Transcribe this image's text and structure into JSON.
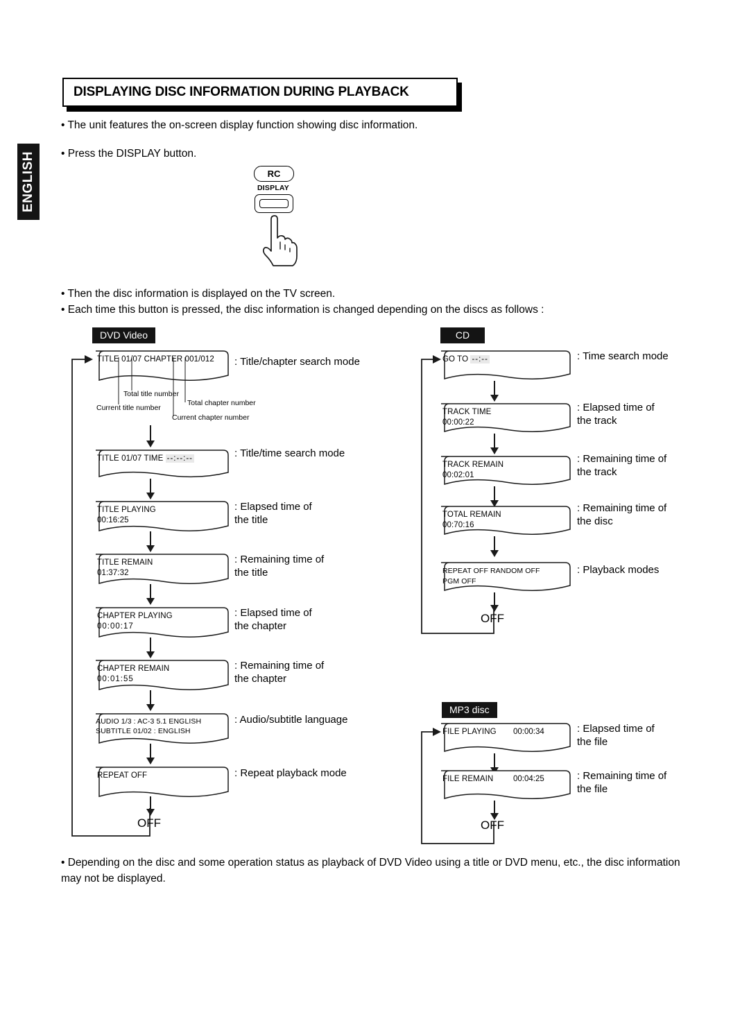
{
  "language_tab": "ENGLISH",
  "header": {
    "title": "DISPLAYING DISC INFORMATION DURING PLAYBACK"
  },
  "intro": {
    "bullet1": "• The unit features the on-screen display function showing disc information.",
    "bullet2": "• Press the DISPLAY button.",
    "bullet3": "• Then the disc information is displayed on the TV screen.",
    "bullet4": "• Each time this button is pressed, the disc information is changed depending on the discs as follows :"
  },
  "remote": {
    "rc_label": "RC",
    "display_label": "DISPLAY",
    "icon": "pointing-hand-icon"
  },
  "dvd": {
    "badge": "DVD Video",
    "steps": [
      {
        "line1": "TITLE 01/07 CHAPTER 001/012",
        "line2": "",
        "placeholder": "",
        "desc": ": Title/chapter search mode"
      },
      {
        "line1": "TITLE 01/07 TIME",
        "line2": "",
        "placeholder": "--:--:--",
        "desc": ": Title/time search mode"
      },
      {
        "line1": "TITLE PLAYING",
        "line2": "00:16:25",
        "placeholder": "",
        "desc": ": Elapsed time of\nthe title"
      },
      {
        "line1": "TITLE REMAIN",
        "line2": "01:37:32",
        "placeholder": "",
        "desc": ": Remaining time of\nthe title"
      },
      {
        "line1": "CHAPTER PLAYING",
        "line2": "00:00:17",
        "placeholder": "",
        "desc": ": Elapsed time of\nthe chapter"
      },
      {
        "line1": "CHAPTER REMAIN",
        "line2": "00:01:55",
        "placeholder": "",
        "desc": ": Remaining time of\nthe chapter"
      },
      {
        "line1": "AUDIO 1/3 :   AC-3   5.1    ENGLISH",
        "line2": "SUBTITLE  01/02 :  ENGLISH",
        "placeholder": "",
        "desc": ": Audio/subtitle language"
      },
      {
        "line1": "REPEAT  OFF",
        "line2": "",
        "placeholder": "",
        "desc": ": Repeat playback mode"
      }
    ],
    "off_label": "OFF",
    "callouts": [
      "Total title number",
      "Current title number",
      "Total chapter number",
      "Current chapter number"
    ]
  },
  "cd": {
    "badge": "CD",
    "steps": [
      {
        "line1": "GO TO",
        "line2": "",
        "placeholder": "--:--",
        "desc": ": Time search mode"
      },
      {
        "line1": "TRACK TIME",
        "line2": "00:00:22",
        "placeholder": "",
        "desc": ": Elapsed time of\nthe track"
      },
      {
        "line1": "TRACK REMAIN",
        "line2": "00:02:01",
        "placeholder": "",
        "desc": ": Remaining time of\nthe track"
      },
      {
        "line1": "TOTAL REMAIN",
        "line2": "00:70:16",
        "placeholder": "",
        "desc": ": Remaining time of\nthe disc"
      },
      {
        "line1": "REPEAT  OFF        RANDOM  OFF",
        "line2": "PGM        OFF",
        "placeholder": "",
        "desc": ": Playback modes"
      }
    ],
    "off_label": "OFF"
  },
  "mp3": {
    "badge": "MP3 disc",
    "steps": [
      {
        "line1": "FILE  PLAYING",
        "right": "00:00:34",
        "desc": ": Elapsed time of\nthe file"
      },
      {
        "line1": "FILE  REMAIN",
        "right": "00:04:25",
        "desc": ": Remaining time of\nthe file"
      }
    ],
    "off_label": "OFF"
  },
  "footer": {
    "note": "• Depending on the disc and some operation status as playback of DVD Video using a title or DVD menu, etc., the disc information may not be displayed."
  }
}
